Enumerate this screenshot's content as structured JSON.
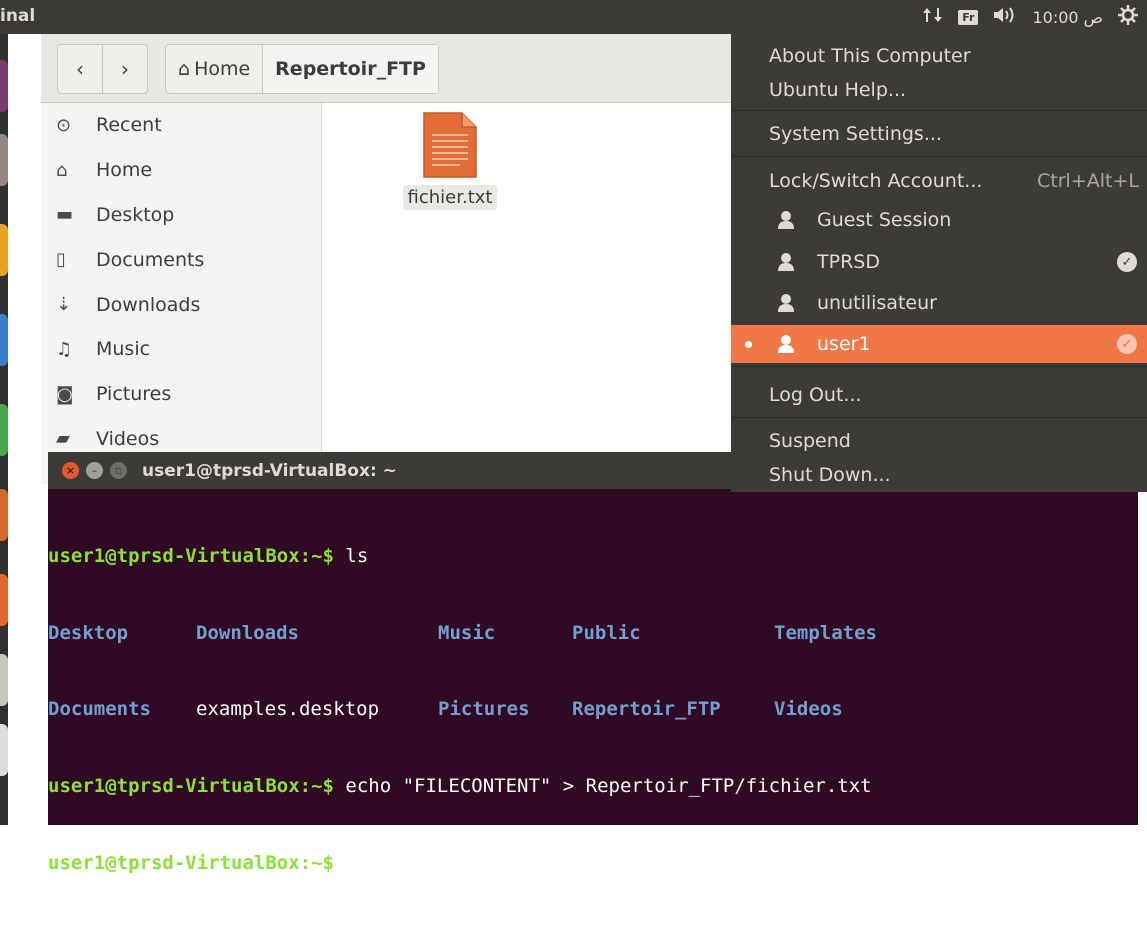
{
  "top_panel": {
    "app_title": "inal",
    "keyboard_layout": "Fr",
    "clock": "10:00 ص",
    "icons": [
      "network-arrows-icon",
      "keyboard-layout-icon",
      "volume-icon",
      "clock",
      "system-gear-icon"
    ]
  },
  "files": {
    "nav": {
      "back": "‹",
      "forward": "›"
    },
    "path": {
      "home": "Home",
      "current": "Repertoir_FTP"
    },
    "sidebar": [
      {
        "label": "Recent",
        "icon": "clock-icon",
        "glyph": "⊙"
      },
      {
        "label": "Home",
        "icon": "home-icon",
        "glyph": "⌂"
      },
      {
        "label": "Desktop",
        "icon": "folder-icon",
        "glyph": "▬"
      },
      {
        "label": "Documents",
        "icon": "document-icon",
        "glyph": "▯"
      },
      {
        "label": "Downloads",
        "icon": "download-icon",
        "glyph": "⇣"
      },
      {
        "label": "Music",
        "icon": "music-icon",
        "glyph": "♫"
      },
      {
        "label": "Pictures",
        "icon": "camera-icon",
        "glyph": "◙"
      },
      {
        "label": "Videos",
        "icon": "video-icon",
        "glyph": "▰"
      }
    ],
    "file": {
      "name": "fichier.txt"
    }
  },
  "terminal": {
    "title": "user1@tprsd-VirtualBox: ~",
    "prompt": "user1@tprsd-VirtualBox:~$",
    "cmd1": " ls",
    "ls_row1": [
      "Desktop",
      "Downloads",
      "Music",
      "Public",
      "Templates"
    ],
    "ls_row2": [
      "Documents",
      "examples.desktop",
      "Pictures",
      "Repertoir_FTP",
      "Videos"
    ],
    "cmd2": " echo \"FILECONTENT\" > Repertoir_FTP/fichier.txt",
    "cmd3": " "
  },
  "menu": {
    "about": "About This Computer",
    "help": "Ubuntu Help...",
    "settings": "System Settings...",
    "lock": "Lock/Switch Account...",
    "lock_shortcut": "Ctrl+Alt+L",
    "users": [
      {
        "name": "Guest Session",
        "checked": false,
        "active": false
      },
      {
        "name": "TPRSD",
        "checked": true,
        "active": false
      },
      {
        "name": "unutilisateur",
        "checked": false,
        "active": false
      },
      {
        "name": "user1",
        "checked": true,
        "active": true
      }
    ],
    "logout": "Log Out...",
    "suspend": "Suspend",
    "shutdown": "Shut Down..."
  },
  "colors": {
    "panel": "#3b3a36",
    "menu_bg": "#3c3b37",
    "accent": "#f07746",
    "terminal_bg": "#300a24",
    "prompt_green": "#8ae234",
    "dir_blue": "#729fcf",
    "file_orange": "#e26d36"
  }
}
